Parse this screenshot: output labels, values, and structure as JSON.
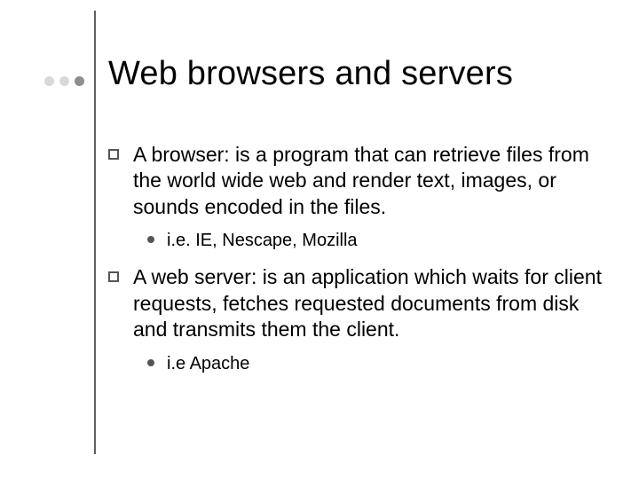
{
  "title": "Web browsers and servers",
  "bullets": {
    "b1": "A browser: is a program that can retrieve files from the world wide web and render text, images, or sounds encoded in the files.",
    "b1_sub": "i.e. IE, Nescape, Mozilla",
    "b2": "A web server: is an application  which waits for client requests, fetches requested documents from disk and transmits them the client.",
    "b2_sub": "i.e Apache"
  }
}
